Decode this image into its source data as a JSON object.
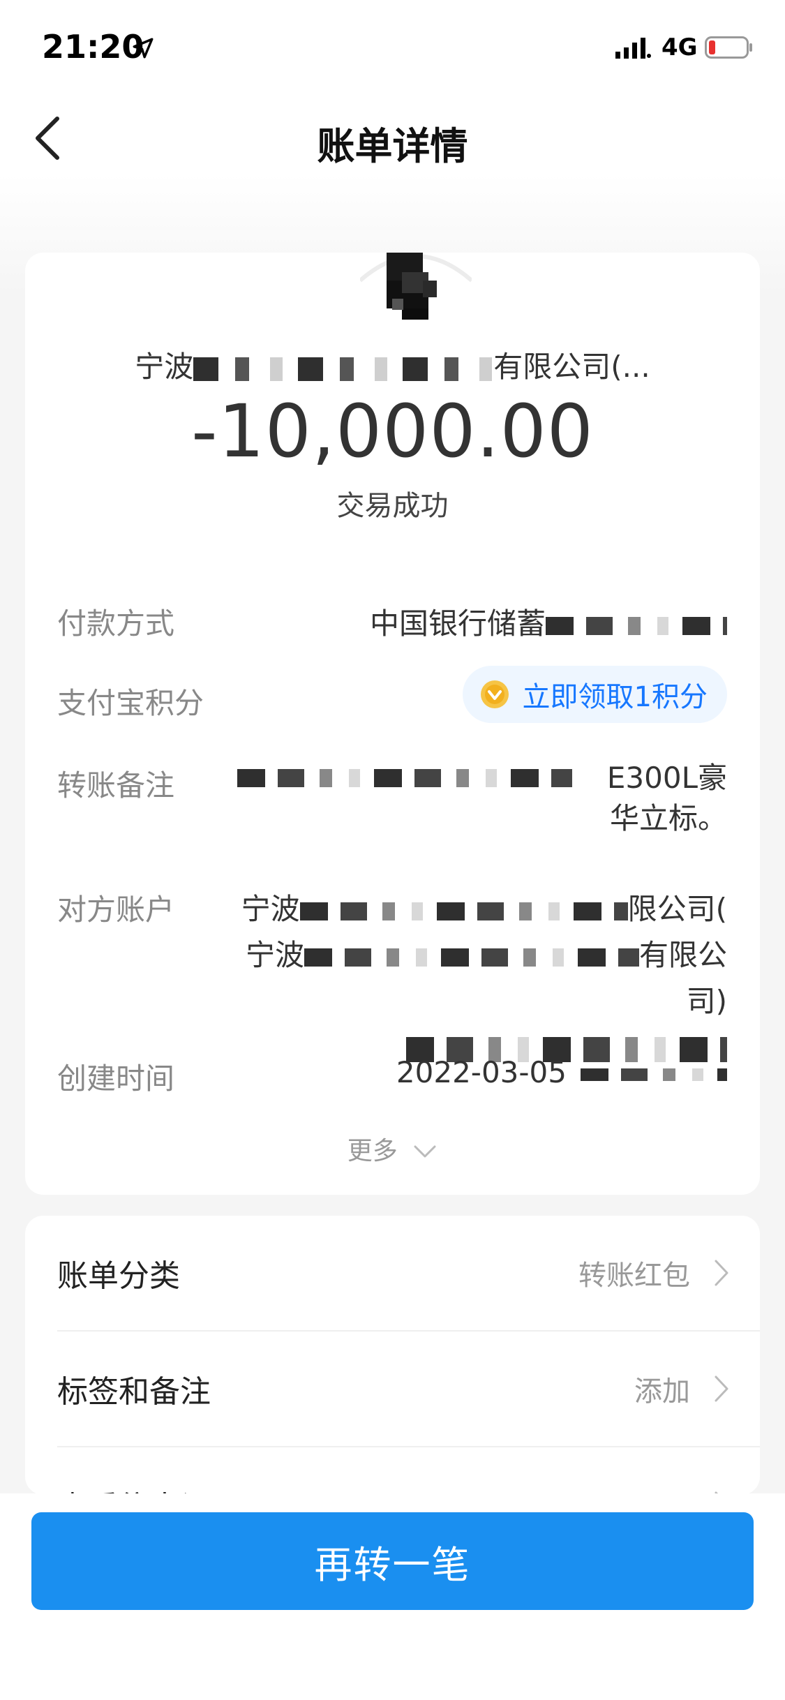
{
  "status_bar": {
    "time": "21:20",
    "network": "4G"
  },
  "nav": {
    "title": "账单详情"
  },
  "bill": {
    "payee_prefix": "宁波",
    "payee_suffix": "有限公司(...",
    "amount": "-10,000.00",
    "status": "交易成功"
  },
  "details": [
    {
      "label": "付款方式",
      "value": "中国银行储蓄"
    },
    {
      "label": "支付宝积分",
      "action": "立即领取1积分"
    },
    {
      "label": "转账备注",
      "value_line1": "E300L豪",
      "value_line2": "华立标。"
    },
    {
      "label": "对方账户",
      "value_line1_prefix": "宁波",
      "value_line1_suffix": "限公司(",
      "value_line2_prefix": "宁波",
      "value_line2_suffix": "有限公司)"
    },
    {
      "label": "创建时间",
      "value": "2022-03-05"
    }
  ],
  "more_label": "更多",
  "options": [
    {
      "label": "账单分类",
      "value": "转账红包"
    },
    {
      "label": "标签和备注",
      "value": "添加"
    },
    {
      "label": "查看往来记录",
      "value": ""
    }
  ],
  "primary_action": "再转一笔",
  "colors": {
    "accent": "#1677ff",
    "button": "#1a8ff0",
    "background": "#f5f5f5"
  }
}
